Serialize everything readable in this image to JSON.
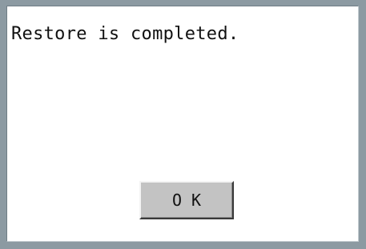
{
  "dialog": {
    "message": "Restore is completed.",
    "ok_label": "O K"
  },
  "colors": {
    "frame": "#8c9aa2",
    "background": "#ffffff",
    "button_face": "#c3c3c3"
  }
}
